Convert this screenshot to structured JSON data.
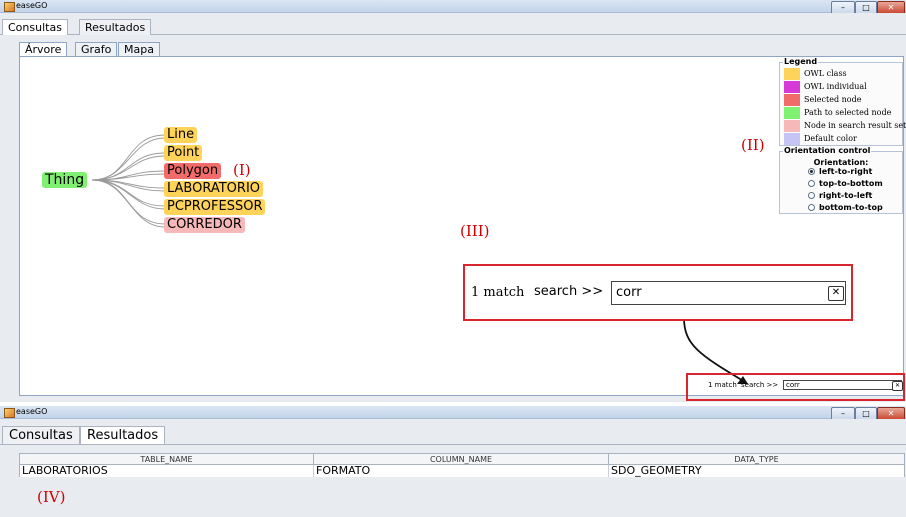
{
  "top_window": {
    "title": "easeGO",
    "menu_tabs": [
      "Consultas",
      "Resultados"
    ],
    "subtabs": [
      "Árvore",
      "Grafo",
      "Mapa"
    ],
    "tree": {
      "root": "Thing",
      "children": [
        "Line",
        "Point",
        "Polygon",
        "LABORATORIO",
        "PCPROFESSOR",
        "CORREDOR"
      ],
      "child_status": [
        "owl-class",
        "owl-class",
        "selected",
        "owl-class",
        "owl-class",
        "search-result"
      ]
    },
    "legend": {
      "title": "Legend",
      "items": [
        {
          "label": "OWL class",
          "color": "#ffd35a"
        },
        {
          "label": "OWL individual",
          "color": "#d63ad6"
        },
        {
          "label": "Selected node",
          "color": "#f26b6b"
        },
        {
          "label": "Path to selected node",
          "color": "#7ff070"
        },
        {
          "label": "Node in search result set",
          "color": "#f6b8b8"
        },
        {
          "label": "Default color",
          "color": "#c6c3f5"
        }
      ]
    },
    "orientation": {
      "title": "Orientation control",
      "subtitle": "Orientation:",
      "options": [
        "left-to-right",
        "top-to-bottom",
        "right-to-left",
        "bottom-to-top"
      ],
      "selected": "left-to-right"
    },
    "search": {
      "match_text": "1 match",
      "label": "search >>",
      "value": "corr"
    },
    "annotations": [
      "(I)",
      "(II)",
      "(III)"
    ]
  },
  "bottom_window": {
    "title": "easeGO",
    "menu_tabs": [
      "Consultas",
      "Resultados"
    ],
    "table": {
      "columns": [
        "TABLE_NAME",
        "COLUMN_NAME",
        "DATA_TYPE"
      ],
      "rows": [
        [
          "LABORATORIOS",
          "FORMATO",
          "SDO_GEOMETRY"
        ]
      ]
    },
    "annotation": "(IV)"
  },
  "colors": {
    "annotation_red": "#d00000",
    "highlight_box": "#d9262e",
    "connector_gray": "#9a9a9a"
  }
}
